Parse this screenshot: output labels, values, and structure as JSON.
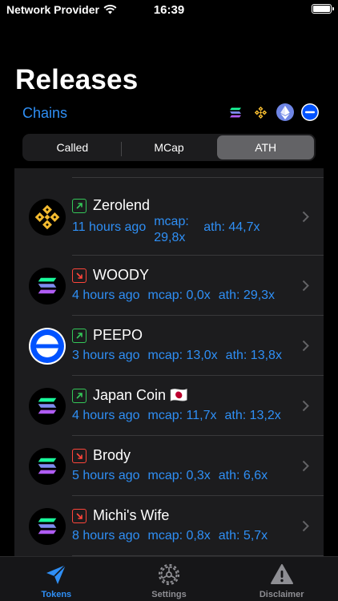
{
  "status_bar": {
    "carrier": "Network Provider",
    "time": "16:39"
  },
  "header": {
    "title": "Releases",
    "chains_label": "Chains"
  },
  "chain_filters": [
    {
      "name": "solana",
      "icon": "solana-icon"
    },
    {
      "name": "bnb",
      "icon": "bnb-icon"
    },
    {
      "name": "ethereum",
      "icon": "ethereum-icon"
    },
    {
      "name": "base",
      "icon": "base-icon"
    }
  ],
  "segments": [
    {
      "label": "Called",
      "active": false
    },
    {
      "label": "MCap",
      "active": false
    },
    {
      "label": "ATH",
      "active": true
    }
  ],
  "releases": [
    {
      "name": "Zerolend",
      "trend": "up",
      "chain": "bnb",
      "time": "11 hours ago",
      "mcap": "mcap: 29,8x",
      "ath": "ath: 44,7x"
    },
    {
      "name": "WOODY",
      "trend": "down",
      "chain": "solana",
      "time": "4 hours ago",
      "mcap": "mcap: 0,0x",
      "ath": "ath: 29,3x"
    },
    {
      "name": "PEEPO",
      "trend": "up",
      "chain": "base",
      "time": "3 hours ago",
      "mcap": "mcap: 13,0x",
      "ath": "ath: 13,8x"
    },
    {
      "name": "Japan Coin 🇯🇵",
      "trend": "up",
      "chain": "solana",
      "time": "4 hours ago",
      "mcap": "mcap: 11,7x",
      "ath": "ath: 13,2x"
    },
    {
      "name": "Brody",
      "trend": "down",
      "chain": "solana",
      "time": "5 hours ago",
      "mcap": "mcap: 0,3x",
      "ath": "ath: 6,6x"
    },
    {
      "name": "Michi's Wife",
      "trend": "down",
      "chain": "solana",
      "time": "8 hours ago",
      "mcap": "mcap: 0,8x",
      "ath": "ath: 5,7x"
    }
  ],
  "tabs": [
    {
      "label": "Tokens",
      "icon": "paper-plane-icon",
      "active": true
    },
    {
      "label": "Settings",
      "icon": "gear-icon",
      "active": false
    },
    {
      "label": "Disclaimer",
      "icon": "warning-icon",
      "active": false
    }
  ],
  "colors": {
    "accent": "#2f8ff5",
    "up": "#34c759",
    "down": "#ff453a"
  }
}
